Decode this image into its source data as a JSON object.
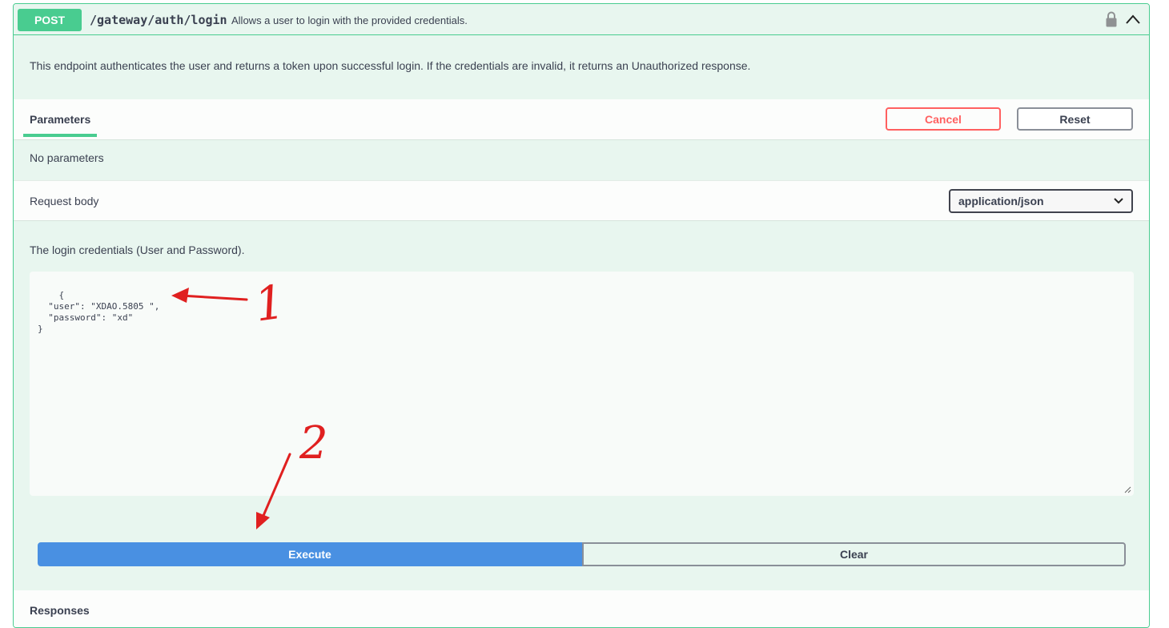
{
  "operation": {
    "method": "POST",
    "path": "/gateway/auth/login",
    "summary": "Allows a user to login with the provided credentials.",
    "description": "This endpoint authenticates the user and returns a token upon successful login. If the credentials are invalid, it returns an Unauthorized response.",
    "colors": {
      "method_bg": "#49cc90",
      "block_bg": "#e8f6ef",
      "border": "#49cc90"
    }
  },
  "parameters": {
    "tab_label": "Parameters",
    "cancel_label": "Cancel",
    "reset_label": "Reset",
    "empty_text": "No parameters"
  },
  "request_body": {
    "label": "Request body",
    "content_type": "application/json",
    "description": "The login credentials (User and Password).",
    "value": "{\n  \"user\": \"XDAO.5805 \",\n  \"password\": \"xd\"\n}"
  },
  "actions": {
    "execute_label": "Execute",
    "clear_label": "Clear",
    "colors": {
      "execute_bg": "#4990e2"
    }
  },
  "responses": {
    "title": "Responses"
  },
  "annotations": {
    "marker_1": "1",
    "marker_2": "2",
    "color": "#e02020"
  },
  "icons": {
    "lock": "lock-icon",
    "collapse": "chevron-up-icon",
    "select": "chevron-down-icon"
  }
}
